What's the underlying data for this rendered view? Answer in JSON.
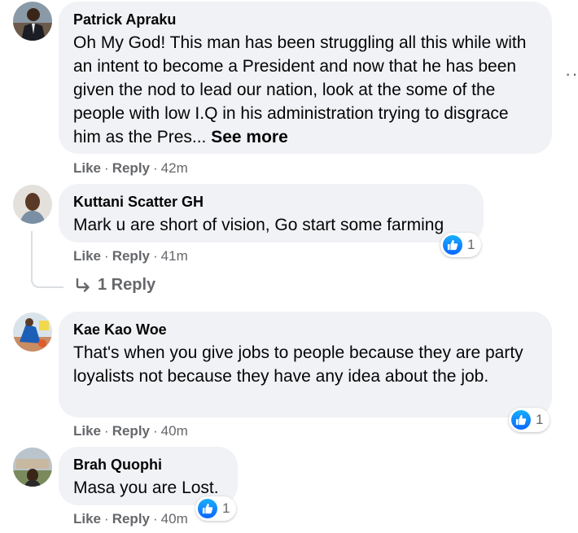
{
  "comments": [
    {
      "author": "Patrick Apraku",
      "text": "Oh My God! This man has been struggling all this while with an intent to become a President and now that he has been given the nod to lead our nation, look at the some of the people with low I.Q in his administration trying to disgrace him as the Pres... ",
      "see_more": "See more",
      "like": "Like",
      "reply": "Reply",
      "time": "42m"
    },
    {
      "author": "Kuttani Scatter GH",
      "text": "Mark u are short of vision, Go start some farming",
      "like": "Like",
      "reply": "Reply",
      "time": "41m",
      "reaction_count": "1",
      "replies_label": "1 Reply"
    },
    {
      "author": "Kae Kao Woe",
      "text": "That's when you give jobs to people because they are party loyalists not because they have any idea about the job.",
      "like": "Like",
      "reply": "Reply",
      "time": "40m",
      "reaction_count": "1"
    },
    {
      "author": "Brah Quophi",
      "text": "Masa you are Lost.",
      "like": "Like",
      "reply": "Reply",
      "time": "40m",
      "reaction_count": "1"
    }
  ],
  "icons": {
    "reply_arrow": "reply-arrow-icon",
    "like_reaction": "thumbs-up-icon",
    "more_options": "more-options-icon"
  },
  "colors": {
    "bubble": "#f0f2f5",
    "meta_text": "#65676b",
    "like_blue": "#0866ff"
  }
}
